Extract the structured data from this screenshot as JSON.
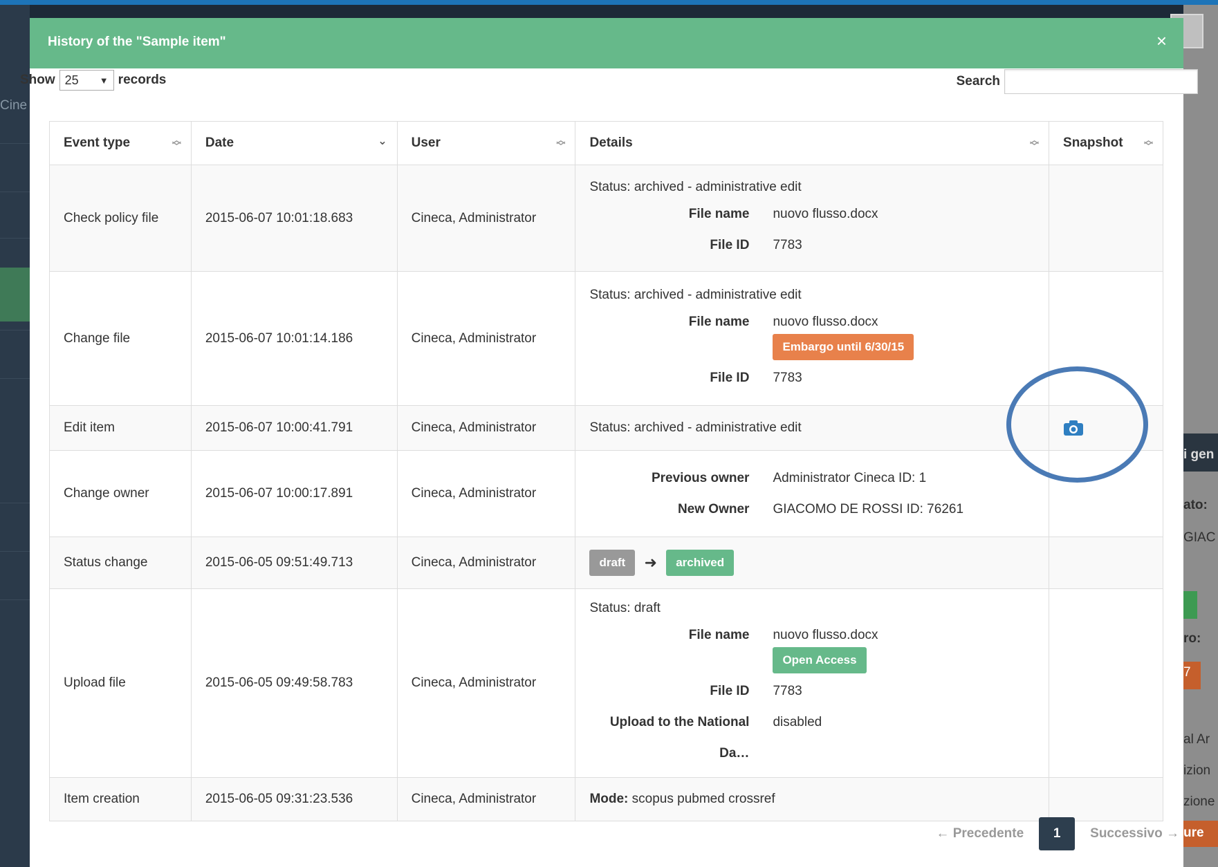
{
  "modal": {
    "title": "History of the \"Sample item\"",
    "close_label": "×"
  },
  "length": {
    "show_label": "Show",
    "value": "25",
    "records_label": "records"
  },
  "search": {
    "label": "Search",
    "value": ""
  },
  "table": {
    "headers": [
      "Event type",
      "Date",
      "User",
      "Details",
      "Snapshot"
    ],
    "rows": [
      {
        "event": "Check policy file",
        "date": "2015-06-07 10:01:18.683",
        "user": "Cineca, Administrator",
        "status": "Status: archived - administrative edit",
        "file_name_label": "File name",
        "file_name": "nuovo flusso.docx",
        "file_id_label": "File ID",
        "file_id": "7783"
      },
      {
        "event": "Change file",
        "date": "2015-06-07 10:01:14.186",
        "user": "Cineca, Administrator",
        "status": "Status: archived - administrative edit",
        "file_name_label": "File name",
        "file_name": "nuovo flusso.docx",
        "badge": "Embargo until 6/30/15",
        "file_id_label": "File ID",
        "file_id": "7783"
      },
      {
        "event": "Edit item",
        "date": "2015-06-07 10:00:41.791",
        "user": "Cineca, Administrator",
        "status": "Status: archived - administrative edit",
        "snapshot_icon": "camera-icon"
      },
      {
        "event": "Change owner",
        "date": "2015-06-07 10:00:17.891",
        "user": "Cineca, Administrator",
        "prev_owner_label": "Previous owner",
        "prev_owner": "Administrator Cineca ID: 1",
        "new_owner_label": "New Owner",
        "new_owner": "GIACOMO DE ROSSI ID: 76261"
      },
      {
        "event": "Status change",
        "date": "2015-06-05 09:51:49.713",
        "user": "Cineca, Administrator",
        "from_status": "draft",
        "arrow": "➜",
        "to_status": "archived"
      },
      {
        "event": "Upload file",
        "date": "2015-06-05 09:49:58.783",
        "user": "Cineca, Administrator",
        "status": "Status: draft",
        "file_name_label": "File name",
        "file_name": "nuovo flusso.docx",
        "badge": "Open Access",
        "file_id_label": "File ID",
        "file_id": "7783",
        "upload_label": "Upload to the National Da…",
        "upload_value": "disabled"
      },
      {
        "event": "Item creation",
        "date": "2015-06-05 09:31:23.536",
        "user": "Cineca, Administrator",
        "mode_label": "Mode:",
        "mode_value": " scopus pubmed crossref"
      }
    ]
  },
  "pagination": {
    "prev": "← Precedente",
    "current": "1",
    "next": "Successivo →"
  },
  "background": {
    "left_fragment": "Cine",
    "right_fragments": [
      "i gen",
      "ato:",
      "GIAC",
      "ro:",
      "7",
      "al Ar",
      "izion",
      "zione",
      "ure"
    ]
  },
  "colors": {
    "header_green": "#66b98a",
    "embargo_orange": "#e8814b",
    "draft_grey": "#999999",
    "pager_dark": "#2d3e4e",
    "highlight_blue": "#4a7ab5",
    "camera_blue": "#2f7fc1"
  }
}
